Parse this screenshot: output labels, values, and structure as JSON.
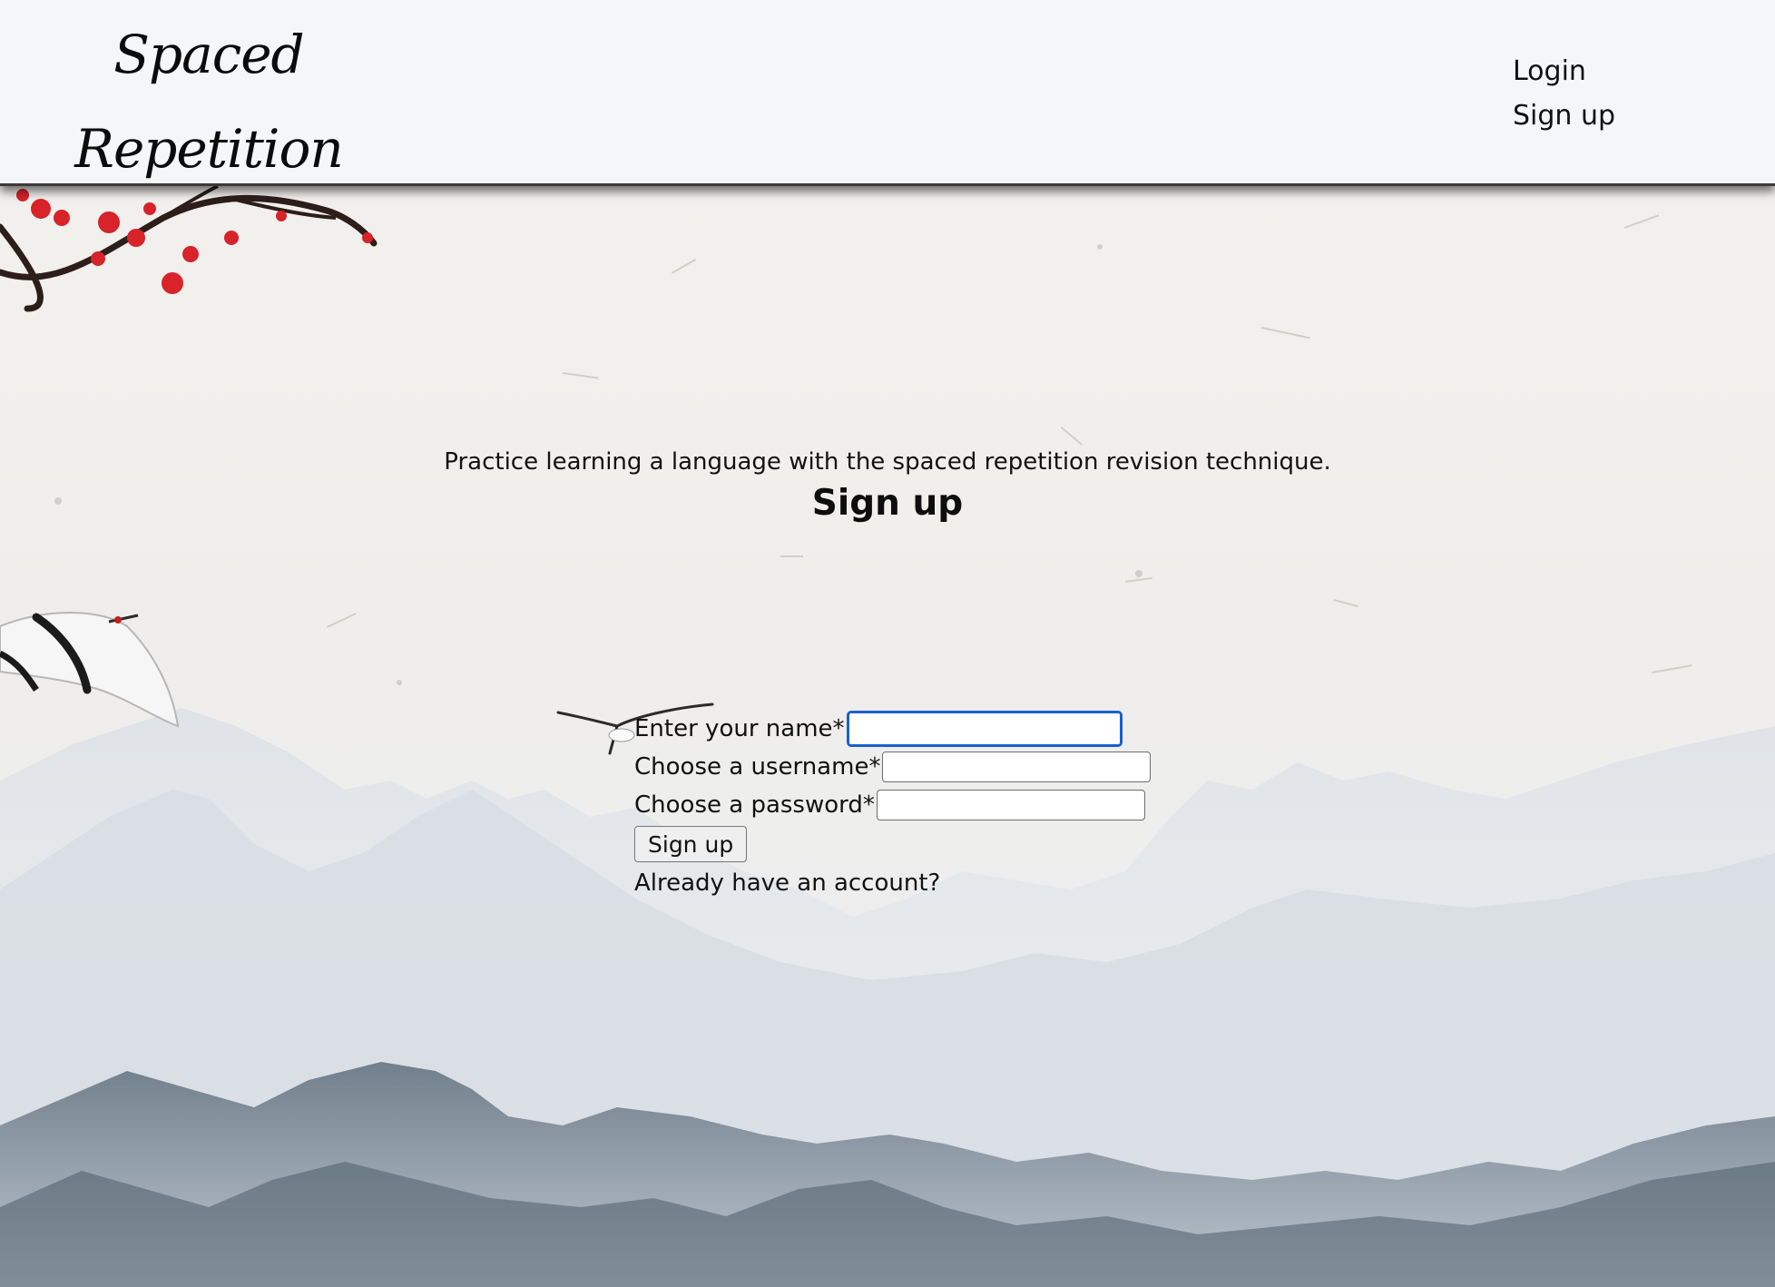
{
  "header": {
    "logo_line1": "Spaced",
    "logo_line2": "Repetition",
    "nav": {
      "login": "Login",
      "signup": "Sign up"
    }
  },
  "main": {
    "tagline": "Practice learning a language with the spaced repetition revision technique.",
    "heading": "Sign up"
  },
  "form": {
    "name_label": "Enter your name*",
    "name_value": "",
    "username_label": "Choose a username*",
    "username_value": "",
    "password_label": "Choose a password*",
    "password_value": "",
    "submit_label": "Sign up",
    "already_text": "Already have an account?"
  },
  "colors": {
    "header_bg": "#f4f6f7",
    "focus_ring": "#1a5fd1",
    "blossom": "#d8232a"
  }
}
